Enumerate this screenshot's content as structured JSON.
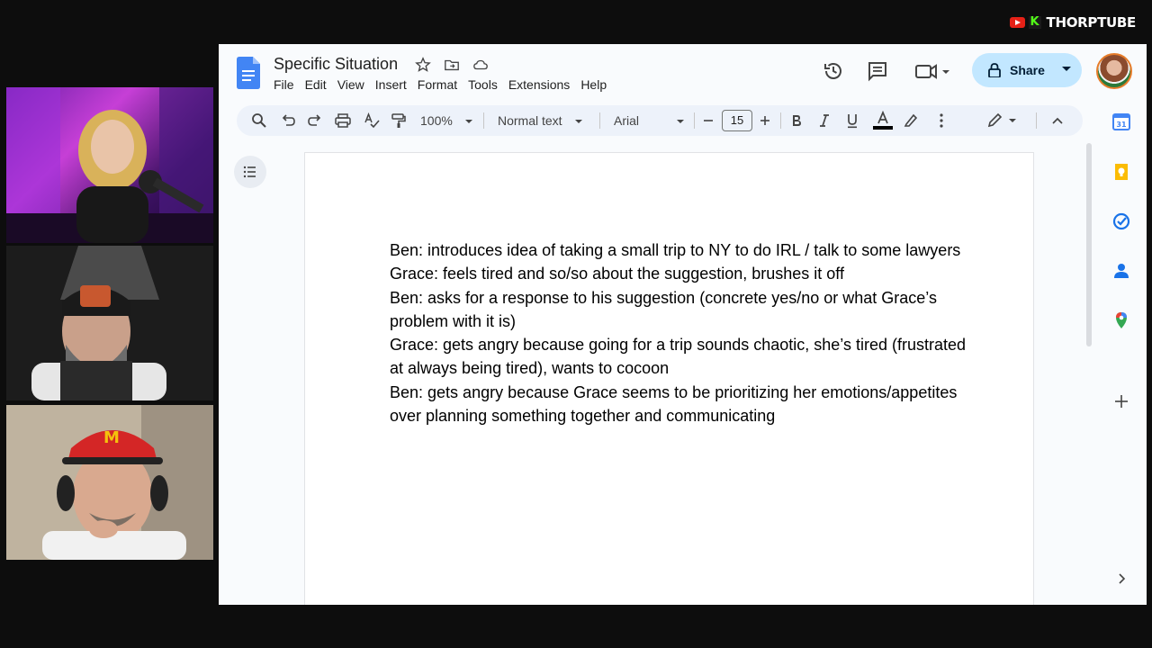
{
  "brand": {
    "name": "THORPTUBE"
  },
  "docs": {
    "title": "Specific Situation",
    "menu": [
      "File",
      "Edit",
      "View",
      "Insert",
      "Format",
      "Tools",
      "Extensions",
      "Help"
    ],
    "share_label": "Share",
    "toolbar": {
      "zoom": "100%",
      "style": "Normal text",
      "font": "Arial",
      "font_size": "15"
    },
    "body": [
      "Ben: introduces idea of taking a small trip to NY to do IRL / talk to some lawyers",
      "Grace: feels tired and so/so about the suggestion, brushes it off",
      "Ben: asks for a response to his suggestion (concrete yes/no or what Grace’s problem with it is)",
      "Grace: gets angry because going for a trip sounds chaotic, she’s tired (frustrated at always being tired), wants to cocoon",
      "Ben: gets angry because Grace seems to be prioritizing her emotions/appetites over planning something together and communicating"
    ]
  },
  "colors": {
    "docs_blue": "#4285f4",
    "share_bg": "#c2e7ff",
    "toolbar_bg": "#edf2fa",
    "app_bg": "#f9fbfd"
  }
}
